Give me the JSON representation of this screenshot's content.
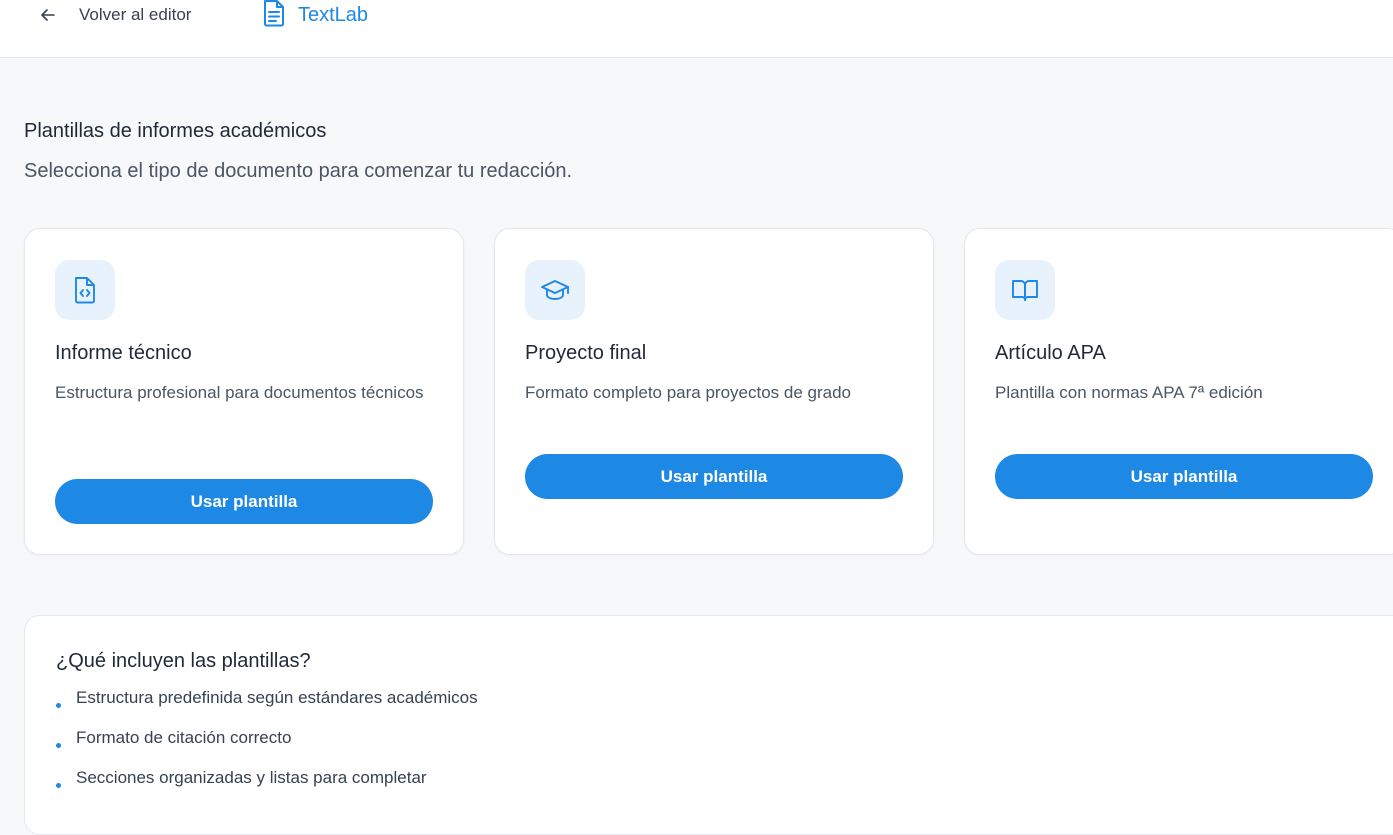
{
  "topbar": {
    "back_label": "Volver al editor",
    "brand_name": "TextLab"
  },
  "page": {
    "heading": "Plantillas de informes académicos",
    "subheading": "Selecciona el tipo de documento para comenzar tu redacción."
  },
  "templates": [
    {
      "icon": "file-code-icon",
      "title": "Informe técnico",
      "description": "Estructura profesional para documentos técnicos",
      "button_label": "Usar plantilla"
    },
    {
      "icon": "graduation-cap-icon",
      "title": "Proyecto final",
      "description": "Formato completo para proyectos de grado",
      "button_label": "Usar plantilla"
    },
    {
      "icon": "book-open-icon",
      "title": "Artículo APA",
      "description": "Plantilla con normas APA 7ª edición",
      "button_label": "Usar plantilla"
    }
  ],
  "includes": {
    "title": "¿Qué incluyen las plantillas?",
    "items": [
      "Estructura predefinida según estándares académicos",
      "Formato de citación correcto",
      "Secciones organizadas y listas para completar"
    ]
  },
  "colors": {
    "accent": "#1e88e5",
    "icon_bg": "#e8f2fd",
    "page_bg": "#f7f8fa"
  }
}
